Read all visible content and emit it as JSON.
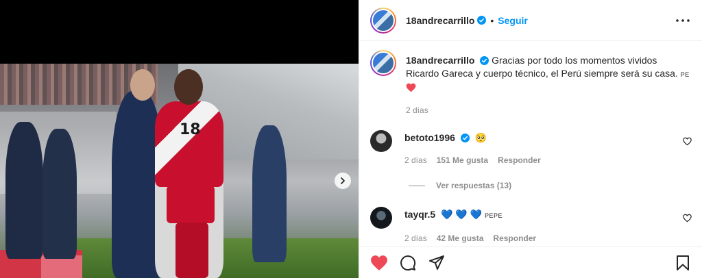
{
  "post": {
    "author": "18andrecarrillo",
    "follow_label": "Seguir",
    "dot": "•",
    "jersey_number": "18",
    "caption": {
      "author": "18andrecarrillo",
      "text": "Gracias por todo los momentos vividos Ricardo Gareca y cuerpo técnico, el Perú siempre será su casa.",
      "tag": "PE",
      "time": "2 días"
    }
  },
  "comments": [
    {
      "author": "betoto1996",
      "verified": true,
      "text": "🥺",
      "time": "2 días",
      "likes": "151 Me gusta",
      "reply_label": "Responder"
    },
    {
      "author": "tayqr.5",
      "verified": false,
      "text": "💙 💙 💙",
      "tag": "PEPE",
      "time": "2 días",
      "likes": "42 Me gusta",
      "reply_label": "Responder"
    }
  ],
  "view_replies": "Ver respuestas (13)",
  "colors": {
    "like": "#ed4956",
    "link": "#0095f6",
    "secondary": "#8e8e8e",
    "blue_heart": "#0095f6"
  },
  "icons": [
    "verified-badge-icon",
    "more-options-icon",
    "like-heart-icon",
    "comment-icon",
    "share-icon",
    "save-bookmark-icon",
    "next-chevron-icon"
  ]
}
